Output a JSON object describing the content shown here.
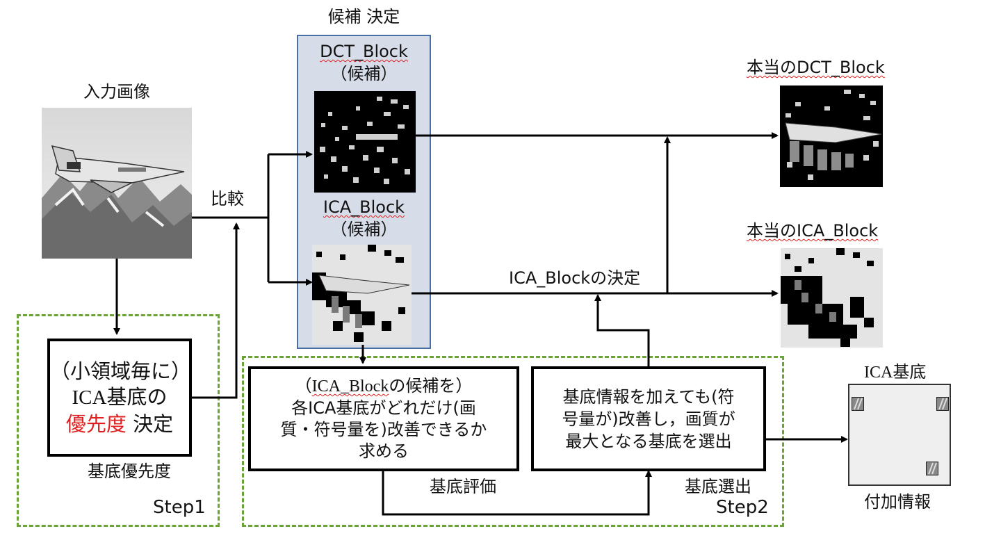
{
  "input_image_label": "入力画像",
  "compare_label": "比較",
  "candidate_header": "候補 決定",
  "dct_candidate_title": "DCT_Block",
  "dct_candidate_sub": "（候補）",
  "ica_candidate_title": "ICA_Block",
  "ica_candidate_sub": "（候補）",
  "true_dct_label": "本当のDCT_Block",
  "true_ica_label": "本当のICA_Block",
  "ica_decision_label": "ICA_Blockの決定",
  "priority_box": {
    "line1": "（小領域毎に）",
    "line2": "ICA基底の",
    "line3_red": "優先度",
    "line3_rest": " 決定"
  },
  "priority_caption": "基底優先度",
  "step1_label": "Step1",
  "eval_box": {
    "line1_pre": "（",
    "line1_serif": "ICA_Block",
    "line1_post": "の候補を）",
    "line2": "各ICA基底がどれだけ(画",
    "line3": "質・符号量を)改善できるか",
    "line4": "求める"
  },
  "eval_caption": "基底評価",
  "select_box": {
    "line1": "基底情報を加えても(符",
    "line2": "号量が)改善し，画質が",
    "line3": "最大となる基底を選出"
  },
  "select_caption": "基底選出",
  "step2_label": "Step2",
  "ica_basis_title": "ICA基底",
  "side_info_label": "付加情報",
  "colors": {
    "dash_green": "#6aa336",
    "candidate_panel": "#d6dce8",
    "candidate_border": "#4a6fa5",
    "red_text": "#e02020"
  }
}
